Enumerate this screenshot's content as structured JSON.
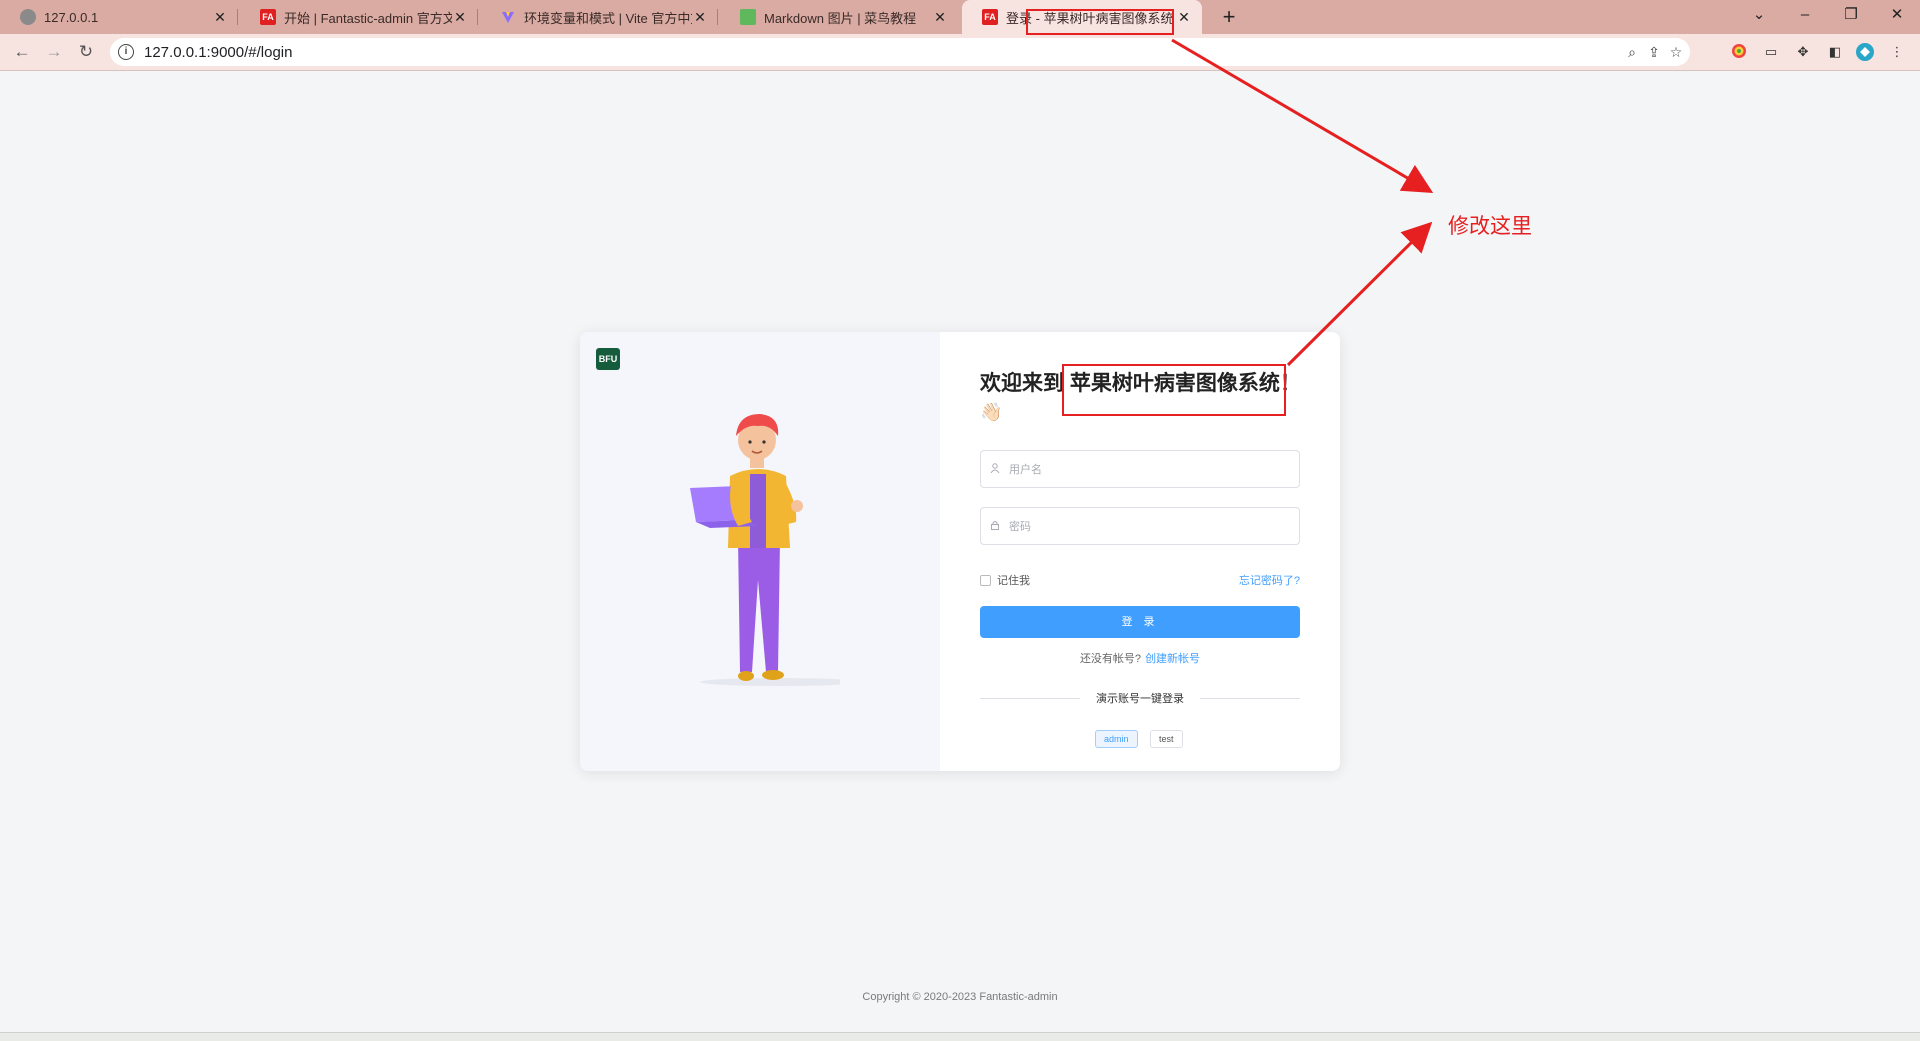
{
  "browser": {
    "tabs": [
      {
        "title": "127.0.0.1",
        "icon": "globe-icon"
      },
      {
        "title": "开始 | Fantastic-admin 官方文档",
        "icon": "fa-logo-icon"
      },
      {
        "title": "环境变量和模式 | Vite 官方中文文档",
        "icon": "vite-logo-icon"
      },
      {
        "title": "Markdown 图片 | 菜鸟教程",
        "icon": "runoob-logo-icon"
      },
      {
        "title": "登录 - 苹果树叶病害图像系统",
        "icon": "fa-logo-icon",
        "active": true
      }
    ],
    "url": "127.0.0.1:9000/#/login",
    "tab_close_glyph": "✕",
    "new_tab_glyph": "+"
  },
  "login": {
    "logo_text": "BFU",
    "welcome_prefix": "欢迎来到",
    "system_name": "苹果树叶病害图像系统",
    "welcome_suffix": "！",
    "wave_emoji": "👋🏻",
    "username_placeholder": "用户名",
    "password_placeholder": "密码",
    "remember_label": "记住我",
    "forgot_label": "忘记密码了?",
    "login_button": "登 录",
    "no_account_text": "还没有帐号?",
    "create_account_link": "创建新帐号",
    "demo_divider": "演示账号一键登录",
    "demo_accounts": [
      "admin",
      "test"
    ]
  },
  "footer": {
    "copyright": "Copyright © 2020-2023  Fantastic-admin"
  },
  "annotation": {
    "text": "修改这里",
    "color": "#e62020"
  },
  "colors": {
    "primary": "#409eff",
    "tabbar": "#d9aba2",
    "logo_bg": "#145c3b"
  }
}
